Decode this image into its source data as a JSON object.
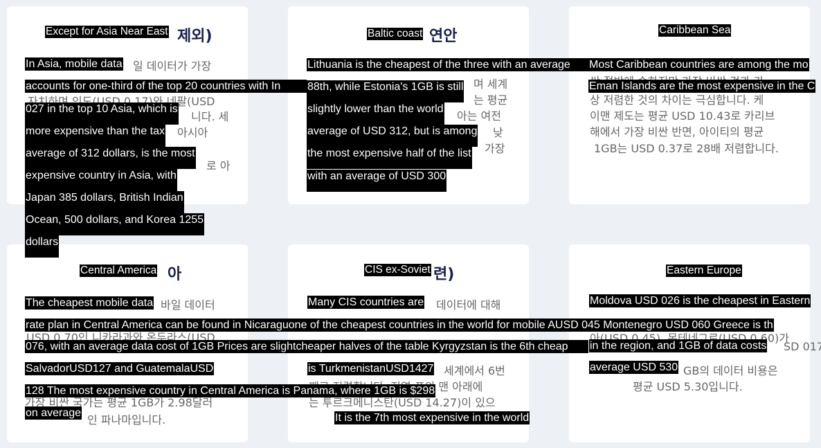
{
  "cards": [
    {
      "title_fragment": "제외)",
      "title_overlay": "Except for Asia Near East",
      "korean_fragments": [
        "일 데이터가 가장",
        "자치하며 인도(USD 0.17)와 네팔(USD",
        "니다. 세",
        "아시아",
        "로 아"
      ],
      "overlay_lines": [
        "In Asia, mobile data",
        " accounts for one-third of the top 20 countries with In",
        "027 in the top 10 Asia, which is",
        "more expensive than the tax",
        "average of 312 dollars, is the most",
        "expensive country in Asia, with",
        "Japan 385 dollars, British Indian",
        "Ocean, 500 dollars, and Korea 1255",
        "dollars"
      ]
    },
    {
      "title_fragment": "연안",
      "title_overlay": "Baltic coast",
      "korean_fragments": [
        "며 세계",
        "는 평균",
        "아는 여전",
        "낮",
        "가장"
      ],
      "overlay_lines": [
        "Lithuania is the cheapest of the three with an average",
        "88th, while Estonia's 1GB is still",
        "slightly lower than the world",
        "average of USD 312, but is among",
        "the most expensive half of the list",
        "with an average of USD 300"
      ]
    },
    {
      "title_overlay": "Caribbean Sea",
      "korean_fragments": [
        "싼 절반에 속하지만 가장 비싼 것과 가",
        "상 저렴한 것의 차이는 극심합니다. 케",
        "이맨 제도는 평균 USD 10.43로 카리브",
        "해에서 가장 비싼 반면, 아이티의 평균",
        "1GB는 USD 0.37로 28배 저렴합니다."
      ],
      "overlay_lines": [
        "Most Caribbean countries are among the mo",
        "Eman Islands are the most expensive in the C"
      ]
    },
    {
      "title_fragment": "아",
      "title_overlay": "Central America",
      "korean_fragments": [
        "바일 데이터",
        "USD 0.70인 니카라과와 온두라스(USD",
        "가장 비싼 국가는 평균 1GB가 2.98달러",
        "인 파나마입니다."
      ],
      "overlay_lines": [
        "The cheapest mobile data",
        " rate plan in Central America can be found in Nicaraguone of the cheapest countries in the world for mobile AUSD 045 Montenegro USD 060 Greece is th",
        "076, with an average data cost of 1GB Prices are slightcheaper halves of the table Kyrgyzstan is the 6th cheap",
        "SalvadorUSD127 and GuatemalaUSD",
        "128 The most expensive country in Central America is Panama, where 1GB is $298",
        " on average"
      ]
    },
    {
      "title_fragment": "련)",
      "title_overlay": "CIS ex-Soviet",
      "korean_fragments": [
        "데이터에 대해",
        "세계에서 6번",
        "째로 저렴합니다. 지역 표의 맨 아래에",
        "는 투르크메니스탄(USD 14.27)이 있으"
      ],
      "overlay_lines": [
        "Many CIS countries are ",
        " is TurkmenistanUSD1427",
        "It is the 7th most expensive in the world"
      ]
    },
    {
      "title_overlay": "Eastern Europe",
      "korean_fragments": [
        "아(USD 0.45), 몬테네그로(USD 0.60)가",
        "SD 017",
        "GB의 데이터 비용은",
        "평균 USD 5.30입니다."
      ],
      "overlay_lines": [
        "Moldova USD 026 is the cheapest in Eastern",
        " in the region, and 1GB of data costs ",
        "average USD 530 "
      ]
    }
  ]
}
